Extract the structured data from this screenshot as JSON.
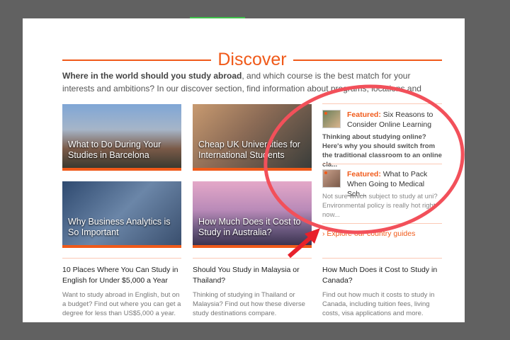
{
  "section": {
    "title": "Discover",
    "intro_bold": "Where in the world should you study abroad",
    "intro_rest": ", and which course is the best match for your interests and ambitions? In our discover section, find information about programs, locations and"
  },
  "cards": [
    {
      "caption": "What to Do During Your Studies in Barcelona"
    },
    {
      "caption": "Cheap UK Universities for International Students"
    },
    {
      "caption": "Why Business Analytics is So Important"
    },
    {
      "caption": "How Much Does it Cost to Study in Australia?"
    }
  ],
  "featured": [
    {
      "label": "Featured:",
      "title": "Six Reasons to Consider Online Learning",
      "desc": "Thinking about studying online? Here's why you should switch from the traditional classroom to an online cla..."
    },
    {
      "label": "Featured:",
      "title": "What to Pack When Going to Medical Sch...",
      "desc": "Not sure which subject to study at uni? Environmental policy is really hot right now..."
    }
  ],
  "explore_link": "Explore our country guides",
  "articles": [
    {
      "title": "10 Places Where You Can Study in English for Under $5,000 a Year",
      "desc": "Want to study abroad in English, but on a budget? Find out where you can get a degree for less than US$5,000 a year."
    },
    {
      "title": "Should You Study in Malaysia or Thailand?",
      "desc": "Thinking of studying in Thailand or Malaysia? Find out how these diverse study destinations compare."
    },
    {
      "title": "How Much Does it Cost to Study in Canada?",
      "desc": "Find out how much it costs to study in Canada, including tuition fees, living costs, visa applications and more."
    }
  ],
  "colors": {
    "accent": "#f05a1a",
    "annotation": "#f2505a"
  }
}
